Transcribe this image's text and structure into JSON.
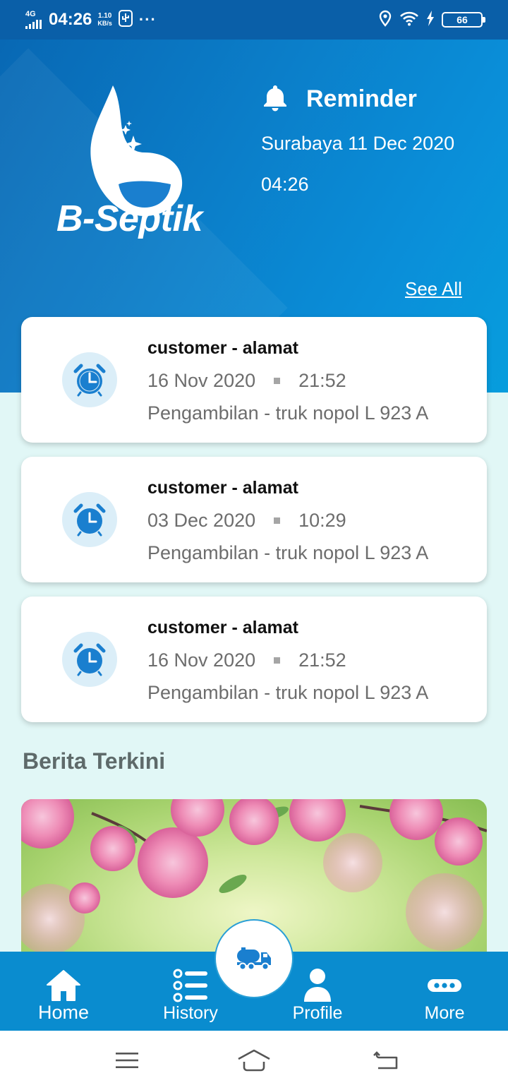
{
  "status_bar": {
    "network": "4G",
    "time": "04:26",
    "speed_value": "1.10",
    "speed_unit": "KB/s",
    "more": "···",
    "battery": "66"
  },
  "app": {
    "logo_text": "B-Septik"
  },
  "reminder": {
    "title": "Reminder",
    "date": "Surabaya 11 Dec 2020",
    "time": "04:26",
    "see_all": "See All",
    "items": [
      {
        "title": "customer - alamat",
        "date": "16 Nov 2020",
        "time": "21:52",
        "desc": "Pengambilan - truk nopol L 923 A"
      },
      {
        "title": "customer - alamat",
        "date": "03 Dec 2020",
        "time": "10:29",
        "desc": "Pengambilan - truk nopol L 923 A"
      },
      {
        "title": "customer - alamat",
        "date": "16 Nov 2020",
        "time": "21:52",
        "desc": "Pengambilan - truk nopol L 923 A"
      }
    ]
  },
  "news": {
    "title": "Berita Terkini"
  },
  "bottom_nav": {
    "home": "Home",
    "history": "History",
    "profile": "Profile",
    "more": "More"
  },
  "colors": {
    "primary": "#0a8ccf",
    "header_dark": "#0868b4",
    "background": "#e1f7f6",
    "status_bar": "#0a5fa8"
  }
}
